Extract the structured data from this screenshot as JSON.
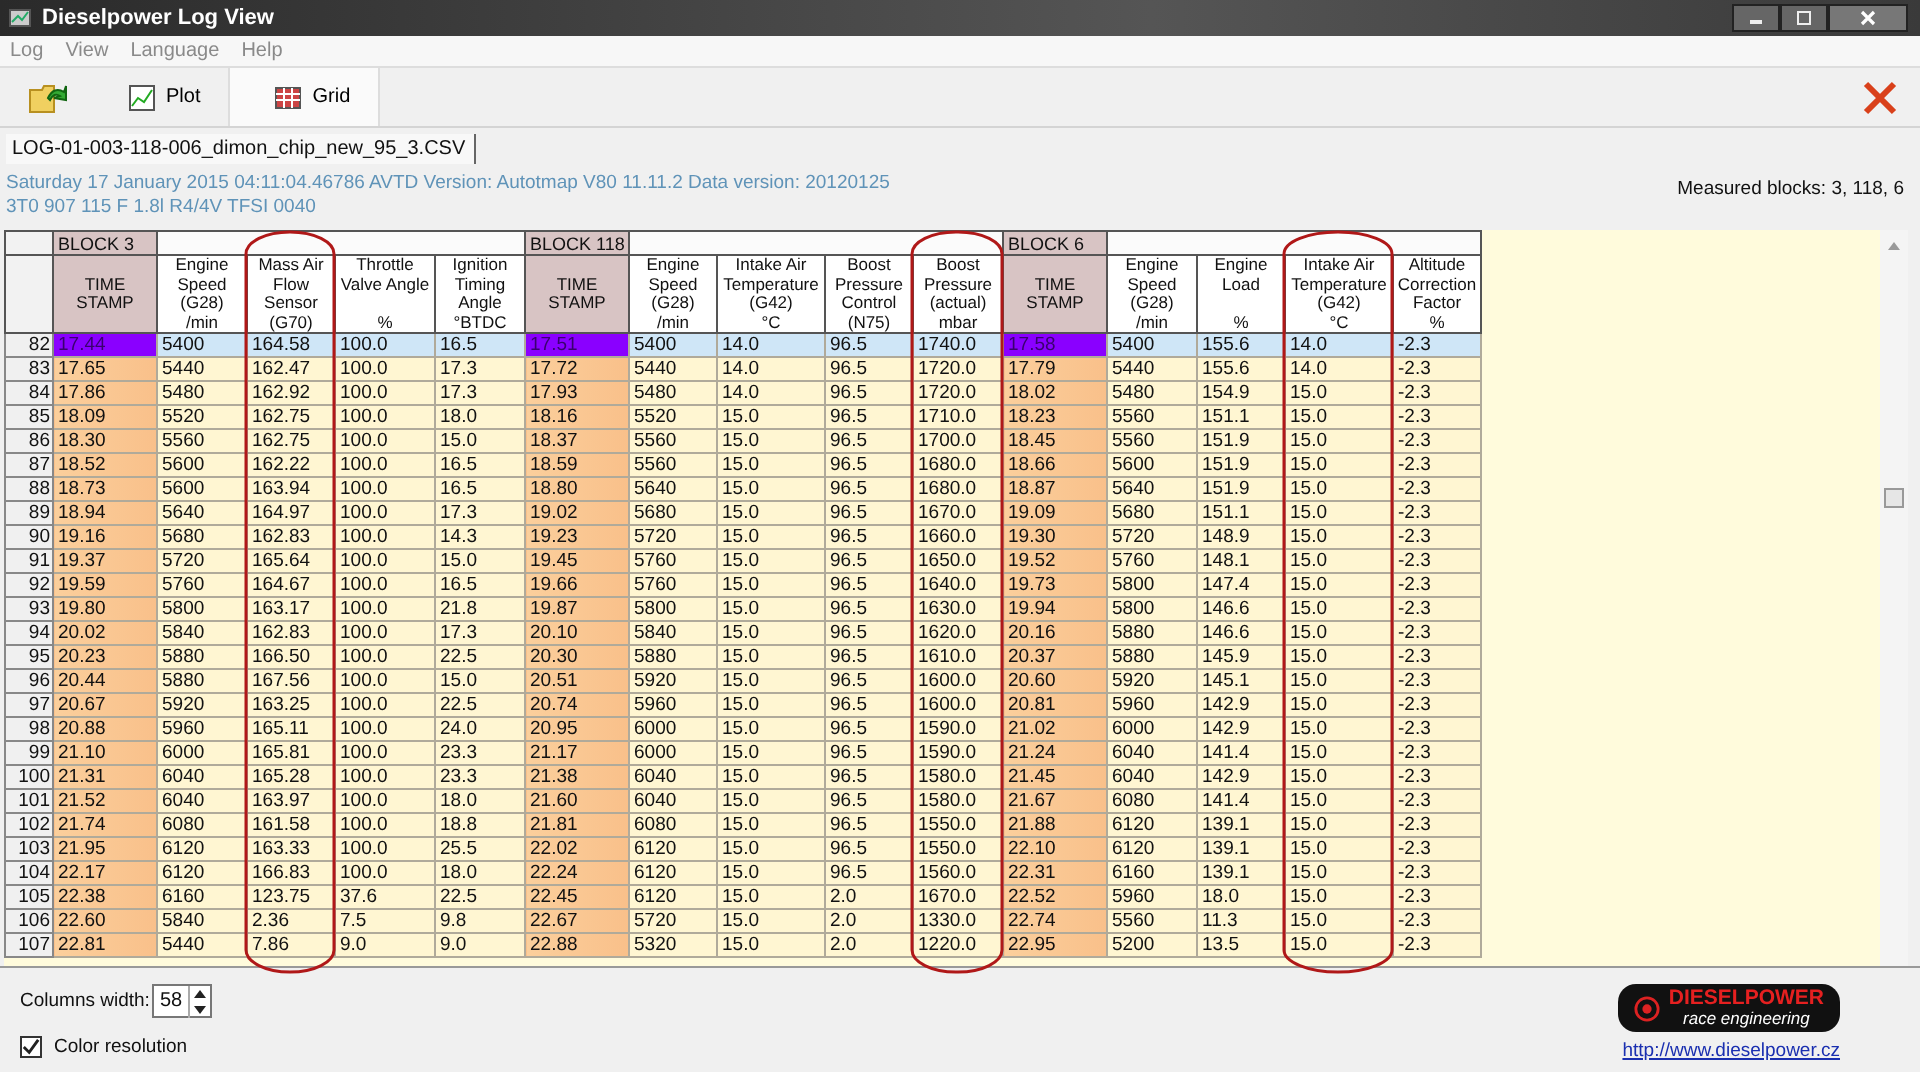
{
  "window": {
    "title": "Dieselpower Log View"
  },
  "menu": [
    "Log",
    "View",
    "Language",
    "Help"
  ],
  "toolbar": {
    "tabs": [
      {
        "label": "Plot",
        "kind": "plot",
        "selected": false
      },
      {
        "label": "Grid",
        "kind": "grid",
        "selected": true
      }
    ]
  },
  "file_tab": {
    "label": "LOG-01-003-118-006_dimon_chip_new_95_3.CSV"
  },
  "info_lines": [
    "Saturday 17 January 2015 04:11:04.46786 AVTD Version: Autotmap V80 11.11.2 Data version: 20120125",
    "3T0 907 115 F  1.8l R4/4V TFSI     0040"
  ],
  "measured_blocks": "Measured blocks: 3, 118, 6",
  "table": {
    "columns": [
      {
        "block": "BLOCK 3",
        "heading": "TIME\nSTAMP",
        "kind": "time"
      },
      {
        "heading": "Engine\nSpeed\n(G28)\n/min",
        "kind": "value"
      },
      {
        "heading": "Mass Air\nFlow\nSensor\n(G70)",
        "kind": "value"
      },
      {
        "heading": "Throttle\nValve Angle\n\n%",
        "kind": "value"
      },
      {
        "heading": "Ignition\nTiming\nAngle\n°BTDC",
        "kind": "value"
      },
      {
        "block": "BLOCK 118",
        "heading": "TIME\nSTAMP",
        "kind": "time"
      },
      {
        "heading": "Engine\nSpeed\n(G28)\n/min",
        "kind": "value"
      },
      {
        "heading": "Intake Air\nTemperature\n(G42)\n°C",
        "kind": "value"
      },
      {
        "heading": "Boost\nPressure\nControl\n(N75)",
        "kind": "value"
      },
      {
        "heading": "Boost\nPressure\n(actual)\nmbar",
        "kind": "value"
      },
      {
        "block": "BLOCK 6",
        "heading": "TIME\nSTAMP",
        "kind": "time"
      },
      {
        "heading": "Engine\nSpeed\n(G28)\n/min",
        "kind": "value"
      },
      {
        "heading": "Engine\nLoad\n\n%",
        "kind": "value"
      },
      {
        "heading": "Intake Air\nTemperature\n(G42)\n°C",
        "kind": "value"
      },
      {
        "heading": "Altitude\nCorrection\nFactor\n%",
        "kind": "value"
      }
    ],
    "rows": [
      {
        "num": "82",
        "selected": true,
        "cells": [
          "17.44",
          "5400",
          "164.58",
          "100.0",
          "16.5",
          "17.51",
          "5400",
          "14.0",
          "96.5",
          "1740.0",
          "17.58",
          "5400",
          "155.6",
          "14.0",
          "-2.3"
        ]
      },
      {
        "num": "83",
        "selected": false,
        "cells": [
          "17.65",
          "5440",
          "162.47",
          "100.0",
          "17.3",
          "17.72",
          "5440",
          "14.0",
          "96.5",
          "1720.0",
          "17.79",
          "5440",
          "155.6",
          "14.0",
          "-2.3"
        ]
      },
      {
        "num": "84",
        "selected": false,
        "cells": [
          "17.86",
          "5480",
          "162.92",
          "100.0",
          "17.3",
          "17.93",
          "5480",
          "14.0",
          "96.5",
          "1720.0",
          "18.02",
          "5480",
          "154.9",
          "15.0",
          "-2.3"
        ]
      },
      {
        "num": "85",
        "selected": false,
        "cells": [
          "18.09",
          "5520",
          "162.75",
          "100.0",
          "18.0",
          "18.16",
          "5520",
          "15.0",
          "96.5",
          "1710.0",
          "18.23",
          "5560",
          "151.1",
          "15.0",
          "-2.3"
        ]
      },
      {
        "num": "86",
        "selected": false,
        "cells": [
          "18.30",
          "5560",
          "162.75",
          "100.0",
          "15.0",
          "18.37",
          "5560",
          "15.0",
          "96.5",
          "1700.0",
          "18.45",
          "5560",
          "151.9",
          "15.0",
          "-2.3"
        ]
      },
      {
        "num": "87",
        "selected": false,
        "cells": [
          "18.52",
          "5600",
          "162.22",
          "100.0",
          "16.5",
          "18.59",
          "5560",
          "15.0",
          "96.5",
          "1680.0",
          "18.66",
          "5600",
          "151.9",
          "15.0",
          "-2.3"
        ]
      },
      {
        "num": "88",
        "selected": false,
        "cells": [
          "18.73",
          "5600",
          "163.94",
          "100.0",
          "16.5",
          "18.80",
          "5640",
          "15.0",
          "96.5",
          "1680.0",
          "18.87",
          "5640",
          "151.9",
          "15.0",
          "-2.3"
        ]
      },
      {
        "num": "89",
        "selected": false,
        "cells": [
          "18.94",
          "5640",
          "164.97",
          "100.0",
          "17.3",
          "19.02",
          "5680",
          "15.0",
          "96.5",
          "1670.0",
          "19.09",
          "5680",
          "151.1",
          "15.0",
          "-2.3"
        ]
      },
      {
        "num": "90",
        "selected": false,
        "cells": [
          "19.16",
          "5680",
          "162.83",
          "100.0",
          "14.3",
          "19.23",
          "5720",
          "15.0",
          "96.5",
          "1660.0",
          "19.30",
          "5720",
          "148.9",
          "15.0",
          "-2.3"
        ]
      },
      {
        "num": "91",
        "selected": false,
        "cells": [
          "19.37",
          "5720",
          "165.64",
          "100.0",
          "15.0",
          "19.45",
          "5760",
          "15.0",
          "96.5",
          "1650.0",
          "19.52",
          "5760",
          "148.1",
          "15.0",
          "-2.3"
        ]
      },
      {
        "num": "92",
        "selected": false,
        "cells": [
          "19.59",
          "5760",
          "164.67",
          "100.0",
          "16.5",
          "19.66",
          "5760",
          "15.0",
          "96.5",
          "1640.0",
          "19.73",
          "5800",
          "147.4",
          "15.0",
          "-2.3"
        ]
      },
      {
        "num": "93",
        "selected": false,
        "cells": [
          "19.80",
          "5800",
          "163.17",
          "100.0",
          "21.8",
          "19.87",
          "5800",
          "15.0",
          "96.5",
          "1630.0",
          "19.94",
          "5800",
          "146.6",
          "15.0",
          "-2.3"
        ]
      },
      {
        "num": "94",
        "selected": false,
        "cells": [
          "20.02",
          "5840",
          "162.83",
          "100.0",
          "17.3",
          "20.10",
          "5840",
          "15.0",
          "96.5",
          "1620.0",
          "20.16",
          "5880",
          "146.6",
          "15.0",
          "-2.3"
        ]
      },
      {
        "num": "95",
        "selected": false,
        "cells": [
          "20.23",
          "5880",
          "166.50",
          "100.0",
          "22.5",
          "20.30",
          "5880",
          "15.0",
          "96.5",
          "1610.0",
          "20.37",
          "5880",
          "145.9",
          "15.0",
          "-2.3"
        ]
      },
      {
        "num": "96",
        "selected": false,
        "cells": [
          "20.44",
          "5880",
          "167.56",
          "100.0",
          "15.0",
          "20.51",
          "5920",
          "15.0",
          "96.5",
          "1600.0",
          "20.60",
          "5920",
          "145.1",
          "15.0",
          "-2.3"
        ]
      },
      {
        "num": "97",
        "selected": false,
        "cells": [
          "20.67",
          "5920",
          "163.25",
          "100.0",
          "22.5",
          "20.74",
          "5960",
          "15.0",
          "96.5",
          "1600.0",
          "20.81",
          "5960",
          "142.9",
          "15.0",
          "-2.3"
        ]
      },
      {
        "num": "98",
        "selected": false,
        "cells": [
          "20.88",
          "5960",
          "165.11",
          "100.0",
          "24.0",
          "20.95",
          "6000",
          "15.0",
          "96.5",
          "1590.0",
          "21.02",
          "6000",
          "142.9",
          "15.0",
          "-2.3"
        ]
      },
      {
        "num": "99",
        "selected": false,
        "cells": [
          "21.10",
          "6000",
          "165.81",
          "100.0",
          "23.3",
          "21.17",
          "6000",
          "15.0",
          "96.5",
          "1590.0",
          "21.24",
          "6040",
          "141.4",
          "15.0",
          "-2.3"
        ]
      },
      {
        "num": "100",
        "selected": false,
        "cells": [
          "21.31",
          "6040",
          "165.28",
          "100.0",
          "23.3",
          "21.38",
          "6040",
          "15.0",
          "96.5",
          "1580.0",
          "21.45",
          "6040",
          "142.9",
          "15.0",
          "-2.3"
        ]
      },
      {
        "num": "101",
        "selected": false,
        "cells": [
          "21.52",
          "6040",
          "163.97",
          "100.0",
          "18.0",
          "21.60",
          "6040",
          "15.0",
          "96.5",
          "1580.0",
          "21.67",
          "6080",
          "141.4",
          "15.0",
          "-2.3"
        ]
      },
      {
        "num": "102",
        "selected": false,
        "cells": [
          "21.74",
          "6080",
          "161.58",
          "100.0",
          "18.8",
          "21.81",
          "6080",
          "15.0",
          "96.5",
          "1550.0",
          "21.88",
          "6120",
          "139.1",
          "15.0",
          "-2.3"
        ]
      },
      {
        "num": "103",
        "selected": false,
        "cells": [
          "21.95",
          "6120",
          "163.33",
          "100.0",
          "25.5",
          "22.02",
          "6120",
          "15.0",
          "96.5",
          "1550.0",
          "22.10",
          "6120",
          "139.1",
          "15.0",
          "-2.3"
        ]
      },
      {
        "num": "104",
        "selected": false,
        "cells": [
          "22.17",
          "6120",
          "166.83",
          "100.0",
          "18.0",
          "22.24",
          "6120",
          "15.0",
          "96.5",
          "1560.0",
          "22.31",
          "6160",
          "139.1",
          "15.0",
          "-2.3"
        ]
      },
      {
        "num": "105",
        "selected": false,
        "cells": [
          "22.38",
          "6160",
          "123.75",
          "37.6",
          "22.5",
          "22.45",
          "6120",
          "15.0",
          "2.0",
          "1670.0",
          "22.52",
          "5960",
          "18.0",
          "15.0",
          "-2.3"
        ]
      },
      {
        "num": "106",
        "selected": false,
        "cells": [
          "22.60",
          "5840",
          "2.36",
          "7.5",
          "9.8",
          "22.67",
          "5720",
          "15.0",
          "2.0",
          "1330.0",
          "22.74",
          "5560",
          "11.3",
          "15.0",
          "-2.3"
        ]
      },
      {
        "num": "107",
        "selected": false,
        "cells": [
          "22.81",
          "5440",
          "7.86",
          "9.0",
          "9.0",
          "22.88",
          "5320",
          "15.0",
          "2.0",
          "1220.0",
          "22.95",
          "5200",
          "13.5",
          "15.0",
          "-2.3"
        ]
      }
    ]
  },
  "columns_width": {
    "label": "Columns width:",
    "value": "58"
  },
  "color_resolution": {
    "label": "Color resolution",
    "checked": true
  },
  "logo": {
    "title": "DIESELPOWER",
    "subtitle": "race engineering"
  },
  "link": "http://www.dieselpower.cz"
}
